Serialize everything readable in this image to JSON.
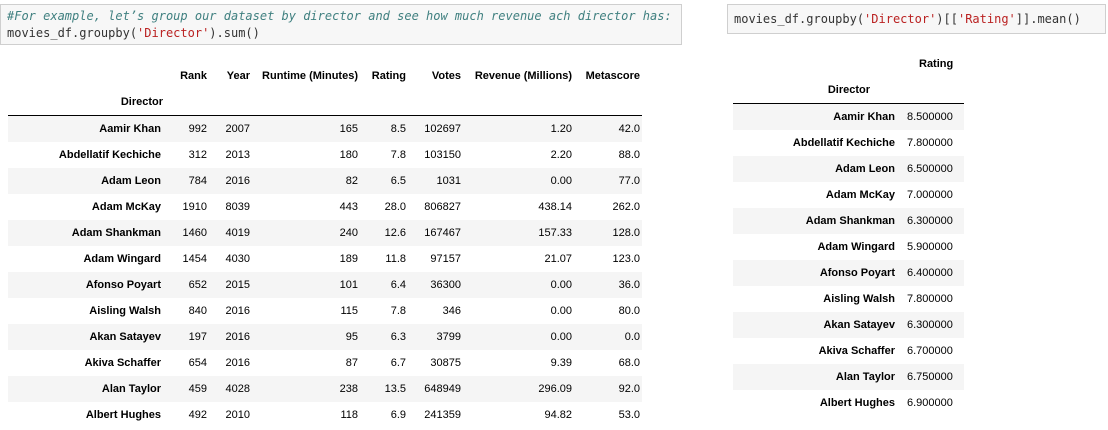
{
  "left_code": {
    "comment": "#For example, let’s group our dataset by director and see how much revenue ach director has:",
    "code_prefix": "movies_df.groupby(",
    "code_string": "'Director'",
    "code_suffix": ").sum()"
  },
  "right_code": {
    "code_prefix": "movies_df.groupby(",
    "code_string1": "'Director'",
    "code_middle": ")[[",
    "code_string2": "'Rating'",
    "code_suffix": "]].mean()"
  },
  "sum_table": {
    "index_name": "Director",
    "columns": [
      "Rank",
      "Year",
      "Runtime (Minutes)",
      "Rating",
      "Votes",
      "Revenue (Millions)",
      "Metascore"
    ],
    "rows": [
      {
        "director": "Aamir Khan",
        "values": [
          "992",
          "2007",
          "165",
          "8.5",
          "102697",
          "1.20",
          "42.0"
        ]
      },
      {
        "director": "Abdellatif Kechiche",
        "values": [
          "312",
          "2013",
          "180",
          "7.8",
          "103150",
          "2.20",
          "88.0"
        ]
      },
      {
        "director": "Adam Leon",
        "values": [
          "784",
          "2016",
          "82",
          "6.5",
          "1031",
          "0.00",
          "77.0"
        ]
      },
      {
        "director": "Adam McKay",
        "values": [
          "1910",
          "8039",
          "443",
          "28.0",
          "806827",
          "438.14",
          "262.0"
        ]
      },
      {
        "director": "Adam Shankman",
        "values": [
          "1460",
          "4019",
          "240",
          "12.6",
          "167467",
          "157.33",
          "128.0"
        ]
      },
      {
        "director": "Adam Wingard",
        "values": [
          "1454",
          "4030",
          "189",
          "11.8",
          "97157",
          "21.07",
          "123.0"
        ]
      },
      {
        "director": "Afonso Poyart",
        "values": [
          "652",
          "2015",
          "101",
          "6.4",
          "36300",
          "0.00",
          "36.0"
        ]
      },
      {
        "director": "Aisling Walsh",
        "values": [
          "840",
          "2016",
          "115",
          "7.8",
          "346",
          "0.00",
          "80.0"
        ]
      },
      {
        "director": "Akan Satayev",
        "values": [
          "197",
          "2016",
          "95",
          "6.3",
          "3799",
          "0.00",
          "0.0"
        ]
      },
      {
        "director": "Akiva Schaffer",
        "values": [
          "654",
          "2016",
          "87",
          "6.7",
          "30875",
          "9.39",
          "68.0"
        ]
      },
      {
        "director": "Alan Taylor",
        "values": [
          "459",
          "4028",
          "238",
          "13.5",
          "648949",
          "296.09",
          "92.0"
        ]
      },
      {
        "director": "Albert Hughes",
        "values": [
          "492",
          "2010",
          "118",
          "6.9",
          "241359",
          "94.82",
          "53.0"
        ]
      }
    ]
  },
  "mean_table": {
    "index_name": "Director",
    "column": "Rating",
    "rows": [
      {
        "director": "Aamir Khan",
        "rating": "8.500000"
      },
      {
        "director": "Abdellatif Kechiche",
        "rating": "7.800000"
      },
      {
        "director": "Adam Leon",
        "rating": "6.500000"
      },
      {
        "director": "Adam McKay",
        "rating": "7.000000"
      },
      {
        "director": "Adam Shankman",
        "rating": "6.300000"
      },
      {
        "director": "Adam Wingard",
        "rating": "5.900000"
      },
      {
        "director": "Afonso Poyart",
        "rating": "6.400000"
      },
      {
        "director": "Aisling Walsh",
        "rating": "7.800000"
      },
      {
        "director": "Akan Satayev",
        "rating": "6.300000"
      },
      {
        "director": "Akiva Schaffer",
        "rating": "6.700000"
      },
      {
        "director": "Alan Taylor",
        "rating": "6.750000"
      },
      {
        "director": "Albert Hughes",
        "rating": "6.900000"
      }
    ]
  }
}
